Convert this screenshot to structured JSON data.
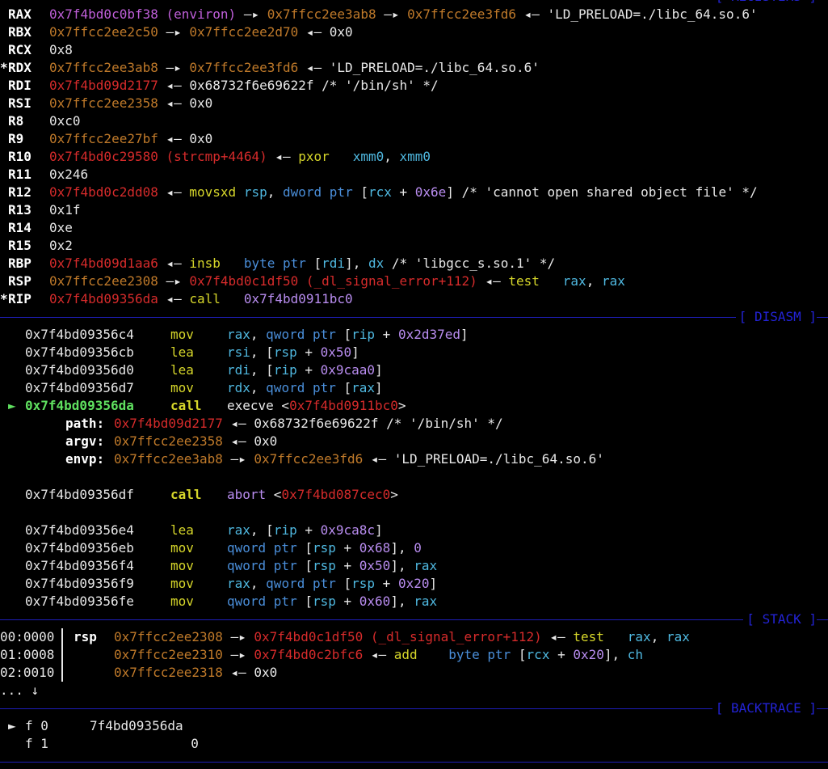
{
  "sections": {
    "registers": "[ REGISTERS ]",
    "disasm": "[ DISASM ]",
    "stack": "[ STACK ]",
    "backtrace": "[ BACKTRACE ]"
  },
  "registers": [
    {
      "star": "",
      "name": "RAX",
      "parts": [
        [
          "0x7f4bd0c0bf38 (environ)",
          "purple"
        ],
        [
          " —▸ ",
          "white"
        ],
        [
          "0x7ffcc2ee3ab8",
          "orange"
        ],
        [
          " —▸ ",
          "white"
        ],
        [
          "0x7ffcc2ee3fd6",
          "orange"
        ],
        [
          " ◂— 'LD_PRELOAD=./libc_64.so.6'",
          "white"
        ]
      ]
    },
    {
      "star": "",
      "name": "RBX",
      "parts": [
        [
          "0x7ffcc2ee2c50",
          "orange"
        ],
        [
          " —▸ ",
          "white"
        ],
        [
          "0x7ffcc2ee2d70",
          "orange"
        ],
        [
          " ◂— 0x0",
          "white"
        ]
      ]
    },
    {
      "star": "",
      "name": "RCX",
      "parts": [
        [
          "0x8",
          "white"
        ]
      ]
    },
    {
      "star": "*",
      "name": "RDX",
      "parts": [
        [
          "0x7ffcc2ee3ab8",
          "orange"
        ],
        [
          " —▸ ",
          "white"
        ],
        [
          "0x7ffcc2ee3fd6",
          "orange"
        ],
        [
          " ◂— 'LD_PRELOAD=./libc_64.so.6'",
          "white"
        ]
      ]
    },
    {
      "star": "",
      "name": "RDI",
      "parts": [
        [
          "0x7f4bd09d2177",
          "red"
        ],
        [
          " ◂— 0x68732f6e69622f /* '/bin/sh' */",
          "white"
        ]
      ]
    },
    {
      "star": "",
      "name": "RSI",
      "parts": [
        [
          "0x7ffcc2ee2358",
          "orange"
        ],
        [
          " ◂— 0x0",
          "white"
        ]
      ]
    },
    {
      "star": "",
      "name": "R8",
      "parts": [
        [
          "0xc0",
          "white"
        ]
      ]
    },
    {
      "star": "",
      "name": "R9",
      "parts": [
        [
          "0x7ffcc2ee27bf",
          "orange"
        ],
        [
          " ◂— 0x0",
          "white"
        ]
      ]
    },
    {
      "star": "",
      "name": "R10",
      "parts": [
        [
          "0x7f4bd0c29580 (strcmp+4464)",
          "red"
        ],
        [
          " ◂— ",
          "white"
        ],
        [
          "pxor",
          "yellow"
        ],
        [
          "   ",
          "white"
        ],
        [
          "xmm0",
          "cyan"
        ],
        [
          ", ",
          "white"
        ],
        [
          "xmm0",
          "cyan"
        ]
      ]
    },
    {
      "star": "",
      "name": "R11",
      "parts": [
        [
          "0x246",
          "white"
        ]
      ]
    },
    {
      "star": "",
      "name": "R12",
      "parts": [
        [
          "0x7f4bd0c2dd08",
          "red"
        ],
        [
          " ◂— ",
          "white"
        ],
        [
          "movsxd",
          "yellow"
        ],
        [
          " ",
          "white"
        ],
        [
          "rsp",
          "cyan"
        ],
        [
          ", ",
          "white"
        ],
        [
          "dword ptr",
          "blue"
        ],
        [
          " [",
          "white"
        ],
        [
          "rcx",
          "cyan"
        ],
        [
          " + ",
          "white"
        ],
        [
          "0x6e",
          "violet"
        ],
        [
          "] /* 'cannot open shared object file' */",
          "white"
        ]
      ]
    },
    {
      "star": "",
      "name": "R13",
      "parts": [
        [
          "0x1f",
          "white"
        ]
      ]
    },
    {
      "star": "",
      "name": "R14",
      "parts": [
        [
          "0xe",
          "white"
        ]
      ]
    },
    {
      "star": "",
      "name": "R15",
      "parts": [
        [
          "0x2",
          "white"
        ]
      ]
    },
    {
      "star": "",
      "name": "RBP",
      "parts": [
        [
          "0x7f4bd09d1aa6",
          "red"
        ],
        [
          " ◂— ",
          "white"
        ],
        [
          "insb",
          "yellow"
        ],
        [
          "   ",
          "white"
        ],
        [
          "byte ptr",
          "blue"
        ],
        [
          " [",
          "white"
        ],
        [
          "rdi",
          "cyan"
        ],
        [
          "], ",
          "white"
        ],
        [
          "dx",
          "cyan"
        ],
        [
          " /* 'libgcc_s.so.1' */",
          "white"
        ]
      ]
    },
    {
      "star": "",
      "name": "RSP",
      "parts": [
        [
          "0x7ffcc2ee2308",
          "orange"
        ],
        [
          " —▸ ",
          "white"
        ],
        [
          "0x7f4bd0c1df50 (_dl_signal_error+112)",
          "red"
        ],
        [
          " ◂— ",
          "white"
        ],
        [
          "test",
          "yellow"
        ],
        [
          "   ",
          "white"
        ],
        [
          "rax",
          "cyan"
        ],
        [
          ", ",
          "white"
        ],
        [
          "rax",
          "cyan"
        ]
      ]
    },
    {
      "star": "*",
      "name": "RIP",
      "parts": [
        [
          "0x7f4bd09356da",
          "red"
        ],
        [
          " ◂— ",
          "white"
        ],
        [
          "call",
          "yellow"
        ],
        [
          "   ",
          "white"
        ],
        [
          "0x7f4bd0911bc0",
          "violet"
        ]
      ]
    }
  ],
  "disasm": [
    {
      "addr": "0x7f4bd09356c4",
      "mnem": "mov",
      "ops": [
        [
          "rax",
          "cyan"
        ],
        [
          ", ",
          "white"
        ],
        [
          "qword ptr",
          "blue"
        ],
        [
          " [",
          "white"
        ],
        [
          "rip",
          "cyan"
        ],
        [
          " + ",
          "white"
        ],
        [
          "0x2d37ed",
          "violet"
        ],
        [
          "]",
          "white"
        ]
      ]
    },
    {
      "addr": "0x7f4bd09356cb",
      "mnem": "lea",
      "ops": [
        [
          "rsi",
          "cyan"
        ],
        [
          ", [",
          "white"
        ],
        [
          "rsp",
          "cyan"
        ],
        [
          " + ",
          "white"
        ],
        [
          "0x50",
          "violet"
        ],
        [
          "]",
          "white"
        ]
      ]
    },
    {
      "addr": "0x7f4bd09356d0",
      "mnem": "lea",
      "ops": [
        [
          "rdi",
          "cyan"
        ],
        [
          ", [",
          "white"
        ],
        [
          "rip",
          "cyan"
        ],
        [
          " + ",
          "white"
        ],
        [
          "0x9caa0",
          "violet"
        ],
        [
          "]",
          "white"
        ]
      ]
    },
    {
      "addr": "0x7f4bd09356d7",
      "mnem": "mov",
      "ops": [
        [
          "rdx",
          "cyan"
        ],
        [
          ", ",
          "white"
        ],
        [
          "qword ptr",
          "blue"
        ],
        [
          " [",
          "white"
        ],
        [
          "rax",
          "cyan"
        ],
        [
          "]",
          "white"
        ]
      ]
    }
  ],
  "current": {
    "marker": "►",
    "addr": "0x7f4bd09356da",
    "mnem": "call",
    "ops": [
      [
        "execve",
        "white"
      ],
      [
        " <",
        "white"
      ],
      [
        "0x7f4bd0911bc0",
        "red"
      ],
      [
        ">",
        "white"
      ]
    ]
  },
  "args": [
    {
      "name": "path:",
      "parts": [
        [
          "0x7f4bd09d2177",
          "red"
        ],
        [
          " ◂— 0x68732f6e69622f /* '/bin/sh' */",
          "white"
        ]
      ]
    },
    {
      "name": "argv:",
      "parts": [
        [
          "0x7ffcc2ee2358",
          "orange"
        ],
        [
          " ◂— 0x0",
          "white"
        ]
      ]
    },
    {
      "name": "envp:",
      "parts": [
        [
          "0x7ffcc2ee3ab8",
          "orange"
        ],
        [
          " —▸ ",
          "white"
        ],
        [
          "0x7ffcc2ee3fd6",
          "orange"
        ],
        [
          " ◂— 'LD_PRELOAD=./libc_64.so.6'",
          "white"
        ]
      ]
    }
  ],
  "disasm2": [
    {
      "addr": "0x7f4bd09356df",
      "mnem": "call",
      "bold": true,
      "ops": [
        [
          "abort",
          "violet"
        ],
        [
          " <",
          "white"
        ],
        [
          "0x7f4bd087cec0",
          "red"
        ],
        [
          ">",
          "white"
        ]
      ]
    }
  ],
  "disasm3": [
    {
      "addr": "0x7f4bd09356e4",
      "mnem": "lea",
      "ops": [
        [
          "rax",
          "cyan"
        ],
        [
          ", [",
          "white"
        ],
        [
          "rip",
          "cyan"
        ],
        [
          " + ",
          "white"
        ],
        [
          "0x9ca8c",
          "violet"
        ],
        [
          "]",
          "white"
        ]
      ]
    },
    {
      "addr": "0x7f4bd09356eb",
      "mnem": "mov",
      "ops": [
        [
          "qword ptr",
          "blue"
        ],
        [
          " [",
          "white"
        ],
        [
          "rsp",
          "cyan"
        ],
        [
          " + ",
          "white"
        ],
        [
          "0x68",
          "violet"
        ],
        [
          "], ",
          "white"
        ],
        [
          "0",
          "violet"
        ]
      ]
    },
    {
      "addr": "0x7f4bd09356f4",
      "mnem": "mov",
      "ops": [
        [
          "qword ptr",
          "blue"
        ],
        [
          " [",
          "white"
        ],
        [
          "rsp",
          "cyan"
        ],
        [
          " + ",
          "white"
        ],
        [
          "0x50",
          "violet"
        ],
        [
          "], ",
          "white"
        ],
        [
          "rax",
          "cyan"
        ]
      ]
    },
    {
      "addr": "0x7f4bd09356f9",
      "mnem": "mov",
      "ops": [
        [
          "rax",
          "cyan"
        ],
        [
          ", ",
          "white"
        ],
        [
          "qword ptr",
          "blue"
        ],
        [
          " [",
          "white"
        ],
        [
          "rsp",
          "cyan"
        ],
        [
          " + ",
          "white"
        ],
        [
          "0x20",
          "violet"
        ],
        [
          "]",
          "white"
        ]
      ]
    },
    {
      "addr": "0x7f4bd09356fe",
      "mnem": "mov",
      "ops": [
        [
          "qword ptr",
          "blue"
        ],
        [
          " [",
          "white"
        ],
        [
          "rsp",
          "cyan"
        ],
        [
          " + ",
          "white"
        ],
        [
          "0x60",
          "violet"
        ],
        [
          "], ",
          "white"
        ],
        [
          "rax",
          "cyan"
        ]
      ]
    }
  ],
  "stack": [
    {
      "off": "00:0000",
      "reg": "rsp",
      "parts": [
        [
          "0x7ffcc2ee2308",
          "orange"
        ],
        [
          " —▸ ",
          "white"
        ],
        [
          "0x7f4bd0c1df50 (_dl_signal_error+112)",
          "red"
        ],
        [
          " ◂— ",
          "white"
        ],
        [
          "test",
          "yellow"
        ],
        [
          "   ",
          "white"
        ],
        [
          "rax",
          "cyan"
        ],
        [
          ", ",
          "white"
        ],
        [
          "rax",
          "cyan"
        ]
      ]
    },
    {
      "off": "01:0008",
      "reg": "",
      "parts": [
        [
          "0x7ffcc2ee2310",
          "orange"
        ],
        [
          " —▸ ",
          "white"
        ],
        [
          "0x7f4bd0c2bfc6",
          "red"
        ],
        [
          " ◂— ",
          "white"
        ],
        [
          "add",
          "yellow"
        ],
        [
          "    ",
          "white"
        ],
        [
          "byte ptr",
          "blue"
        ],
        [
          " [",
          "white"
        ],
        [
          "rcx",
          "cyan"
        ],
        [
          " + ",
          "white"
        ],
        [
          "0x20",
          "violet"
        ],
        [
          "], ",
          "white"
        ],
        [
          "ch",
          "cyan"
        ]
      ]
    },
    {
      "off": "02:0010",
      "reg": "",
      "parts": [
        [
          "0x7ffcc2ee2318",
          "orange"
        ],
        [
          " ◂— 0x0",
          "white"
        ]
      ]
    }
  ],
  "stack_more": "... ↓",
  "backtrace": [
    {
      "mark": "►",
      "frame": "f 0",
      "addr": "7f4bd09356da"
    },
    {
      "mark": "",
      "frame": "f 1",
      "addr": "             0"
    }
  ]
}
